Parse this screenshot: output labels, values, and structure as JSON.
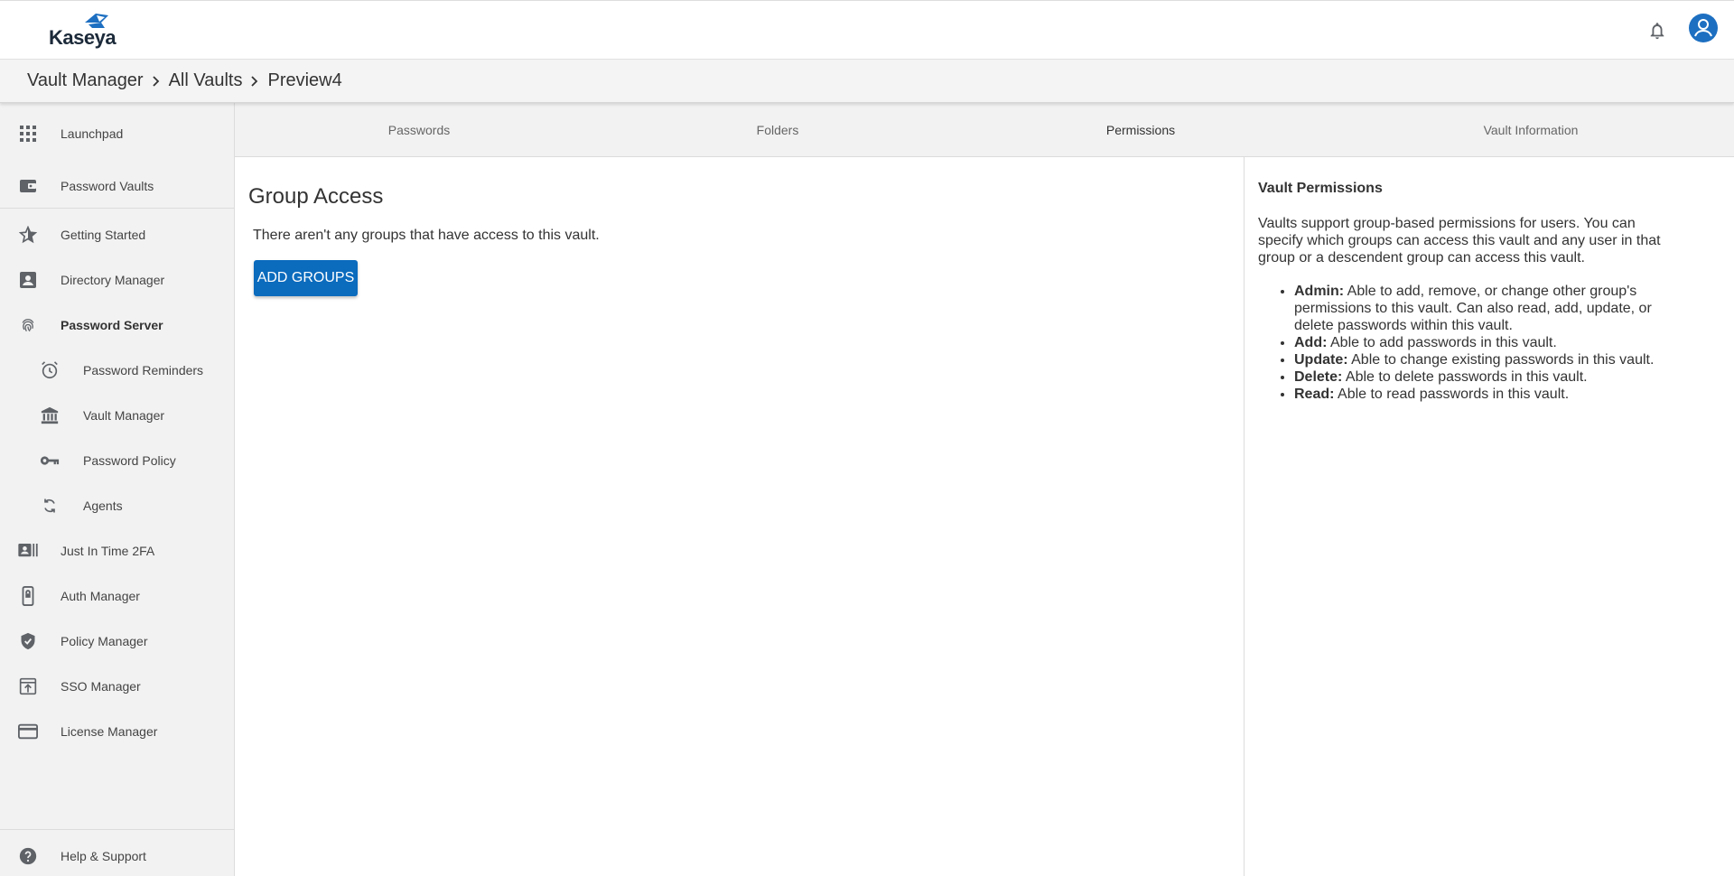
{
  "header": {
    "logo_text": "Kaseya"
  },
  "breadcrumb": [
    {
      "label": "Vault Manager"
    },
    {
      "label": "All Vaults"
    },
    {
      "label": "Preview4"
    }
  ],
  "sidebar": {
    "items": [
      {
        "label": "Launchpad",
        "icon": "grid-icon"
      },
      {
        "label": "Password Vaults",
        "icon": "wallet-icon"
      },
      {
        "label": "Getting Started",
        "icon": "star-icon"
      },
      {
        "label": "Directory Manager",
        "icon": "contact-card-icon"
      },
      {
        "label": "Password Server",
        "icon": "fingerprint-icon"
      },
      {
        "label": "Password Reminders",
        "icon": "alarm-icon"
      },
      {
        "label": "Vault Manager",
        "icon": "bank-icon"
      },
      {
        "label": "Password Policy",
        "icon": "key-icon"
      },
      {
        "label": "Agents",
        "icon": "sync-icon"
      },
      {
        "label": "Just In Time 2FA",
        "icon": "badge-icon"
      },
      {
        "label": "Auth Manager",
        "icon": "phone-lock-icon"
      },
      {
        "label": "Policy Manager",
        "icon": "shield-check-icon"
      },
      {
        "label": "SSO Manager",
        "icon": "sso-icon"
      },
      {
        "label": "License Manager",
        "icon": "credit-card-icon"
      }
    ],
    "help_label": "Help & Support"
  },
  "tabs": [
    {
      "label": "Passwords"
    },
    {
      "label": "Folders"
    },
    {
      "label": "Permissions"
    },
    {
      "label": "Vault Information"
    }
  ],
  "main": {
    "title": "Group Access",
    "empty_message": "There aren't any groups that have access to this vault.",
    "add_button": "ADD GROUPS"
  },
  "info": {
    "title": "Vault Permissions",
    "description": "Vaults support group-based permissions for users. You can specify which groups can access this vault and any user in that group or a descendent group can access this vault.",
    "permissions": [
      {
        "name": "Admin:",
        "text": "Able to add, remove, or change other group's permissions to this vault. Can also read, add, update, or delete passwords within this vault."
      },
      {
        "name": "Add:",
        "text": "Able to add passwords in this vault."
      },
      {
        "name": "Update:",
        "text": "Able to change existing passwords in this vault."
      },
      {
        "name": "Delete:",
        "text": "Able to delete passwords in this vault."
      },
      {
        "name": "Read:",
        "text": "Able to read passwords in this vault."
      }
    ]
  },
  "colors": {
    "accent": "#0b6bbd",
    "sidebar_bg": "#f2f2f2",
    "icon": "#5f6368"
  }
}
